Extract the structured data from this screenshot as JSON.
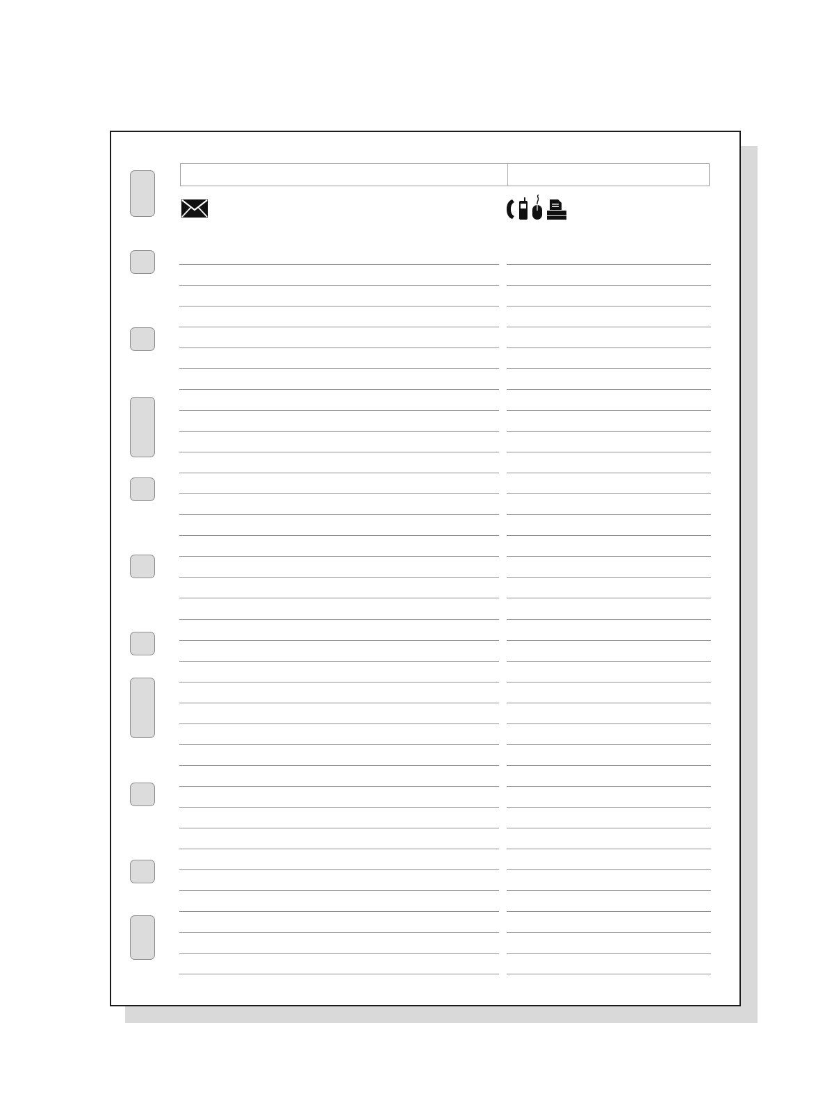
{
  "page": {
    "background": "#ffffff",
    "shadow_color": "#d9d9d9",
    "hole_color": "#dcdcdc",
    "rule_color": "#8f8f8f"
  },
  "icons": {
    "address": "envelope-icon",
    "contact": [
      "phone-icon",
      "mobile-phone-icon",
      "mouse-icon",
      "fax-icon"
    ]
  },
  "binder_hole_count": 11,
  "ruled_line_count": 35,
  "columns": [
    "address",
    "contact"
  ]
}
